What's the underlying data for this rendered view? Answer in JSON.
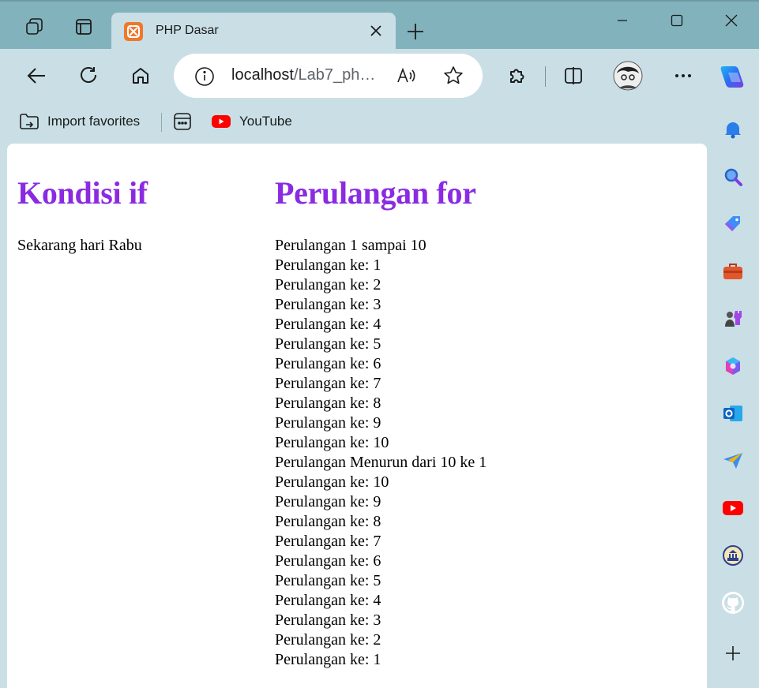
{
  "tab": {
    "favicon": "xampp-icon",
    "title": "PHP Dasar"
  },
  "address": {
    "host": "localhost",
    "path": "/Lab7_ph…"
  },
  "favorites": {
    "import_label": "Import favorites",
    "youtube_label": "YouTube"
  },
  "page": {
    "left_heading": "Kondisi if",
    "left_text": "Sekarang hari Rabu",
    "right_heading": "Perulangan for",
    "lines": [
      "Perulangan 1 sampai 10",
      "Perulangan ke: 1",
      "Perulangan ke: 2",
      "Perulangan ke: 3",
      "Perulangan ke: 4",
      "Perulangan ke: 5",
      "Perulangan ke: 6",
      "Perulangan ke: 7",
      "Perulangan ke: 8",
      "Perulangan ke: 9",
      "Perulangan ke: 10",
      "Perulangan Menurun dari 10 ke 1",
      "Perulangan ke: 10",
      "Perulangan ke: 9",
      "Perulangan ke: 8",
      "Perulangan ke: 7",
      "Perulangan ke: 6",
      "Perulangan ke: 5",
      "Perulangan ke: 4",
      "Perulangan ke: 3",
      "Perulangan ke: 2",
      "Perulangan ke: 1"
    ]
  },
  "colors": {
    "frame": "#82b2bc",
    "toolbar": "#c9dfe5",
    "heading": "#8a2be2",
    "tab_favicon": "#f0782c"
  },
  "sidebar_icons": [
    "bell-icon",
    "search-icon",
    "shopping-tag-icon",
    "tools-icon",
    "games-icon",
    "microsoft365-icon",
    "outlook-icon",
    "send-icon",
    "youtube-icon",
    "institution-icon",
    "github-icon",
    "add-icon"
  ]
}
